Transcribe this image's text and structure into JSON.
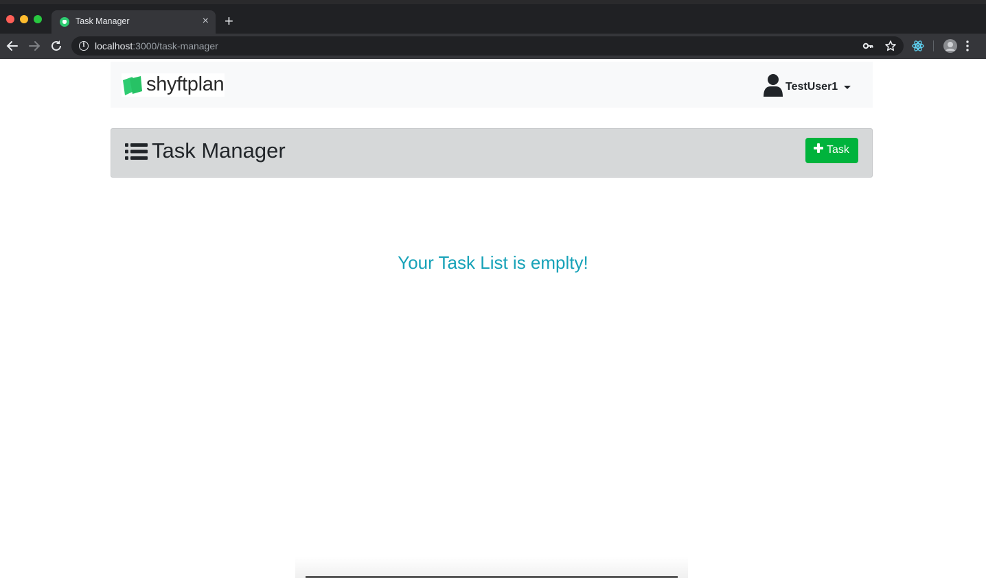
{
  "browser": {
    "tab_title": "Task Manager",
    "tab_close": "×",
    "new_tab": "+",
    "url_host": "localhost",
    "url_path": ":3000/task-manager"
  },
  "app": {
    "logo_text": "shyftplan",
    "user_name": "TestUser1",
    "page_title": "Task Manager",
    "add_task_label": "Task",
    "empty_message": "Your Task List is emplty!"
  },
  "colors": {
    "brand_green": "#2ecc71",
    "add_button": "#00b33c",
    "empty_message": "#17a2b8",
    "header_bg": "#d6d8d9"
  },
  "icons": {
    "nav_back": "arrow-left-icon",
    "nav_forward": "arrow-right-icon",
    "reload": "reload-icon",
    "site_info": "info-icon",
    "password": "key-icon",
    "bookmark": "star-icon",
    "extension": "react-devtools-icon",
    "profile": "profile-avatar-icon",
    "menu": "kebab-menu-icon",
    "user": "user-icon",
    "list": "list-icon",
    "add": "plus-icon"
  }
}
